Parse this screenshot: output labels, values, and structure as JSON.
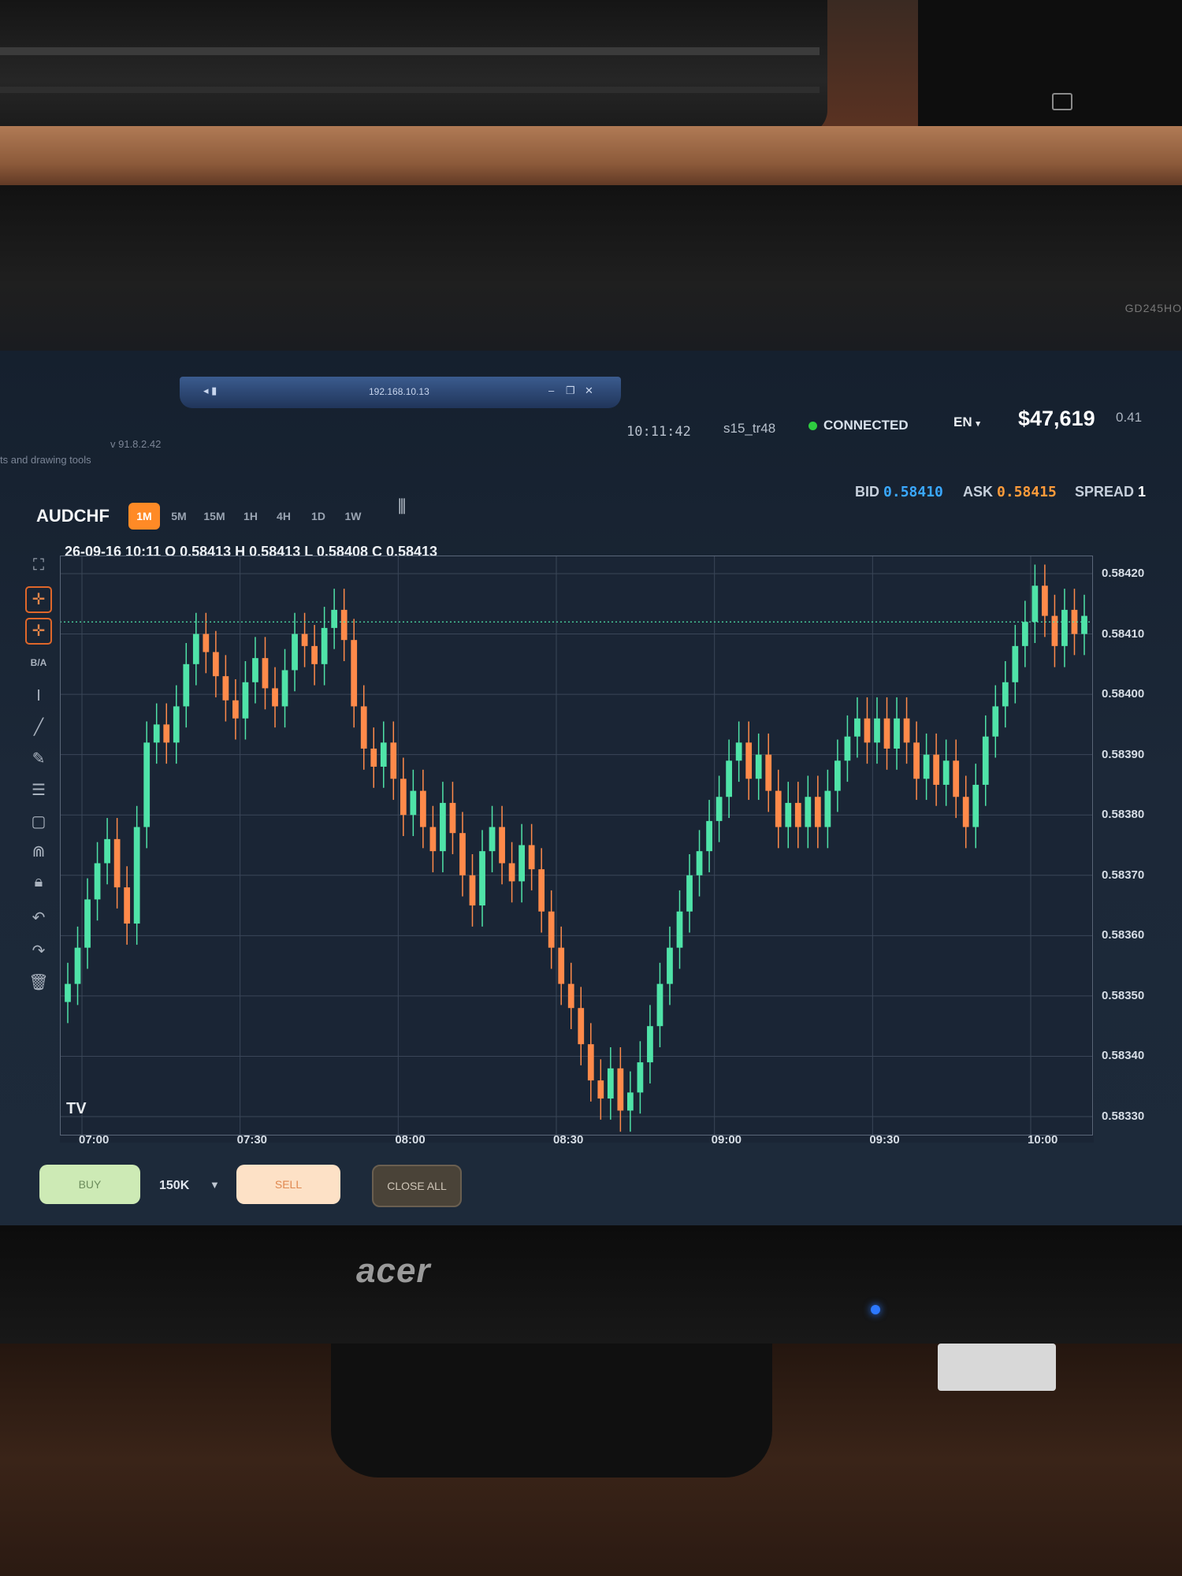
{
  "window": {
    "title_ip": "192.168.10.13"
  },
  "app": {
    "version": "v 91.8.2.42",
    "drawing_tip": "ts and drawing tools"
  },
  "header": {
    "clock": "10:11:42",
    "user": "s15_tr48",
    "connection": "CONNECTED",
    "language": "EN",
    "balance": "$47,619",
    "extra_value": "0.41"
  },
  "quote": {
    "bid_label": "BID",
    "bid": "0.58410",
    "ask_label": "ASK",
    "ask": "0.58415",
    "spread_label": "SPREAD",
    "spread": "1"
  },
  "instrument": {
    "symbol": "AUDCHF",
    "timeframes": [
      "1M",
      "5M",
      "15M",
      "1H",
      "4H",
      "1D",
      "1W"
    ],
    "active_timeframe": "1M"
  },
  "ohlc_line": "26-09-16 10:11 O 0.58413 H 0.58413 L 0.58408 C 0.58413",
  "toolbar": {
    "bid_ask_label": "B/A"
  },
  "chart_data": {
    "type": "bar",
    "price_ticks": [
      "0.58420",
      "0.58410",
      "0.58400",
      "0.58390",
      "0.58380",
      "0.58370",
      "0.58360",
      "0.58350",
      "0.58340",
      "0.58330"
    ],
    "time_ticks": [
      "07:00",
      "07:30",
      "08:00",
      "08:30",
      "09:00",
      "09:30",
      "10:00"
    ],
    "ylim": [
      0.58327,
      0.58423
    ],
    "current_price": 0.58412,
    "series_close": [
      0.58352,
      0.58358,
      0.58366,
      0.58372,
      0.58376,
      0.58368,
      0.58362,
      0.58378,
      0.58392,
      0.58395,
      0.58392,
      0.58398,
      0.58405,
      0.5841,
      0.58407,
      0.58403,
      0.58399,
      0.58396,
      0.58402,
      0.58406,
      0.58401,
      0.58398,
      0.58404,
      0.5841,
      0.58408,
      0.58405,
      0.58411,
      0.58414,
      0.58409,
      0.58398,
      0.58391,
      0.58388,
      0.58392,
      0.58386,
      0.5838,
      0.58384,
      0.58378,
      0.58374,
      0.58382,
      0.58377,
      0.5837,
      0.58365,
      0.58374,
      0.58378,
      0.58372,
      0.58369,
      0.58375,
      0.58371,
      0.58364,
      0.58358,
      0.58352,
      0.58348,
      0.58342,
      0.58336,
      0.58333,
      0.58338,
      0.58331,
      0.58334,
      0.58339,
      0.58345,
      0.58352,
      0.58358,
      0.58364,
      0.5837,
      0.58374,
      0.58379,
      0.58383,
      0.58389,
      0.58392,
      0.58386,
      0.5839,
      0.58384,
      0.58378,
      0.58382,
      0.58378,
      0.58383,
      0.58378,
      0.58384,
      0.58389,
      0.58393,
      0.58396,
      0.58392,
      0.58396,
      0.58391,
      0.58396,
      0.58392,
      0.58386,
      0.5839,
      0.58385,
      0.58389,
      0.58383,
      0.58378,
      0.58385,
      0.58393,
      0.58398,
      0.58402,
      0.58408,
      0.58412,
      0.58418,
      0.58413,
      0.58408,
      0.58414,
      0.5841,
      0.58413
    ]
  },
  "order": {
    "buy_label": "BUY",
    "quantity": "150K",
    "sell_label": "SELL",
    "close_all_label": "CLOSE ALL"
  },
  "monitor": {
    "brand": "acer",
    "model": "GD245HO"
  },
  "colors": {
    "bull": "#4fe3a8",
    "bear": "#ff8a4a",
    "accent": "#ff8a26",
    "bid": "#3aa8ff",
    "ask": "#ff9b3a"
  }
}
